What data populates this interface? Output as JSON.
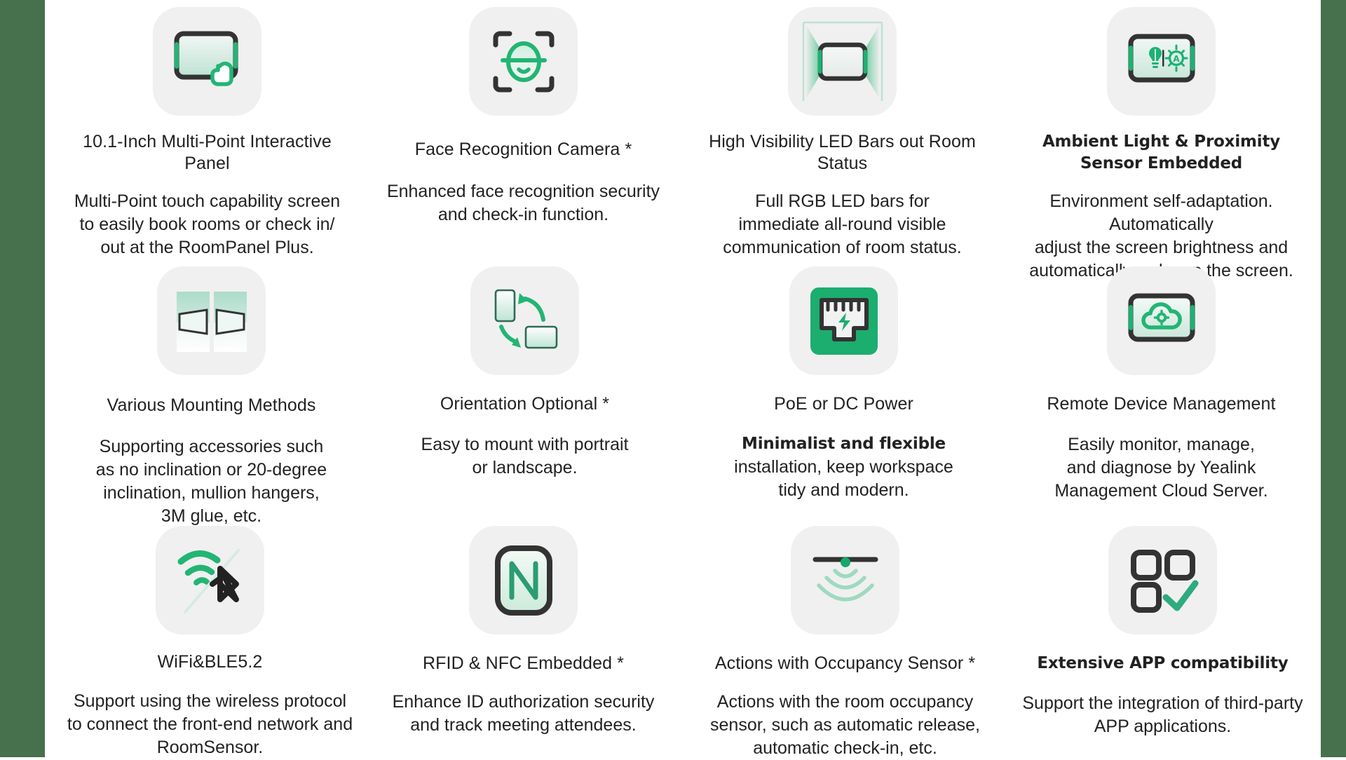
{
  "theme": {
    "accent_green": "#22b573",
    "band_green": "#47704d",
    "tile_grey": "#f0f0f0",
    "dark": "#333333",
    "text": "#212121"
  },
  "features": [
    {
      "icon": "interactive-panel-touch-icon",
      "title": "10.1-Inch Multi-Point\nInteractive Panel",
      "description": "Multi-Point touch capability screen\nto easily book rooms or check in/\nout at the RoomPanel Plus.",
      "title_style": "regular"
    },
    {
      "icon": "face-recognition-camera-icon",
      "title": "Face Recognition Camera *",
      "description": "Enhanced face recognition security\nand check-in function.",
      "title_style": "regular"
    },
    {
      "icon": "led-bars-room-status-icon",
      "title": "High Visibility LED Bars\nout Room Status",
      "description": "Full RGB LED bars for\nimmediate all-round visible\ncommunication of room status.",
      "title_style": "regular"
    },
    {
      "icon": "ambient-light-proximity-sensor-icon",
      "title": "Ambient Light & Proximity\nSensor Embedded",
      "description": "Environment self-adaptation. Automatically\nadjust the screen brightness and\nautomatically wake up the screen.",
      "title_style": "alt",
      "title_line1": "Ambient Light & Proximity",
      "title_line2": "Sensor Embedded"
    },
    {
      "icon": "various-mounting-methods-icon",
      "title": "Various Mounting Methods",
      "description": "Supporting accessories such\nas no inclination or 20-degree\ninclination, mullion hangers,\n3M glue, etc.",
      "title_style": "regular"
    },
    {
      "icon": "orientation-rotate-icon",
      "title": "Orientation Optional *",
      "description": "Easy to mount with portrait\nor landscape.",
      "title_style": "regular"
    },
    {
      "icon": "poe-ethernet-power-icon",
      "title": "PoE or DC Power",
      "description_emph": "Minimalist and flexible",
      "description": "installation, keep workspace\ntidy and modern.",
      "title_style": "regular"
    },
    {
      "icon": "remote-device-cloud-management-icon",
      "title": "Remote Device Management",
      "description": "Easily monitor, manage,\nand diagnose by Yealink\nManagement Cloud Server.",
      "title_style": "regular"
    },
    {
      "icon": "wifi-bluetooth-icon",
      "title": "WiFi&BLE5.2",
      "description": "Support using the wireless protocol\nto connect the front-end network and\nRoomSensor.",
      "title_style": "regular"
    },
    {
      "icon": "nfc-rfid-icon",
      "title": "RFID & NFC Embedded *",
      "description": "Enhance ID authorization security\nand track meeting attendees.",
      "title_style": "regular"
    },
    {
      "icon": "occupancy-sensor-icon",
      "title": "Actions with Occupancy Sensor *",
      "description": "Actions with the room occupancy\nsensor, such as automatic release,\nautomatic check-in, etc.",
      "title_style": "regular"
    },
    {
      "icon": "app-compatibility-grid-check-icon",
      "title": "Extensive APP compatibility",
      "description": "Support the integration of third-party\nAPP applications.",
      "title_style": "alt"
    }
  ]
}
